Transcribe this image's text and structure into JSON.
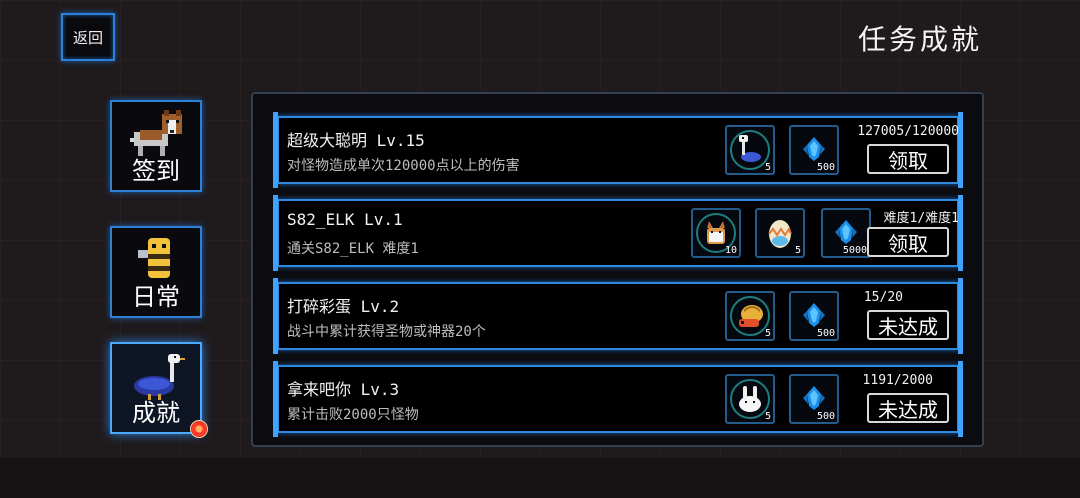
{
  "header": {
    "back_label": "返回",
    "title": "任务成就"
  },
  "tabs": [
    {
      "label": "签到",
      "icon": "dog-icon"
    },
    {
      "label": "日常",
      "icon": "bee-icon"
    },
    {
      "label": "成就",
      "icon": "bird-icon",
      "active": true
    }
  ],
  "achievements": [
    {
      "title": "超级大聪明 Lv.15",
      "desc": "对怪物造成单次120000点以上的伤害",
      "progress": "127005/120000",
      "action": "领取",
      "rewards": [
        {
          "icon": "ostrich-pet-icon",
          "count": "5"
        },
        {
          "icon": "blue-crystal-icon",
          "count": "500"
        }
      ]
    },
    {
      "title": "S82_ELK Lv.1",
      "desc": "通关S82_ELK 难度1",
      "progress": "难度1/难度1",
      "action": "领取",
      "rewards": [
        {
          "icon": "cat-pet-icon",
          "count": "10"
        },
        {
          "icon": "egg-icon",
          "count": "5"
        },
        {
          "icon": "blue-crystal-icon",
          "count": "5000"
        }
      ]
    },
    {
      "title": "打碎彩蛋 Lv.2",
      "desc": "战斗中累计获得圣物或神器20个",
      "progress": "15/20",
      "action": "未达成",
      "rewards": [
        {
          "icon": "hermit-crab-pet-icon",
          "count": "5"
        },
        {
          "icon": "blue-crystal-icon",
          "count": "500"
        }
      ]
    },
    {
      "title": "拿来吧你 Lv.3",
      "desc": "累计击败2000只怪物",
      "progress": "1191/2000",
      "action": "未达成",
      "rewards": [
        {
          "icon": "rabbit-pet-icon",
          "count": "5"
        },
        {
          "icon": "blue-crystal-icon",
          "count": "500"
        }
      ]
    }
  ],
  "colors": {
    "frame_blue": "#2f8ae0",
    "background": "#1f1a1c",
    "badge_red": "#ff3a2a"
  }
}
